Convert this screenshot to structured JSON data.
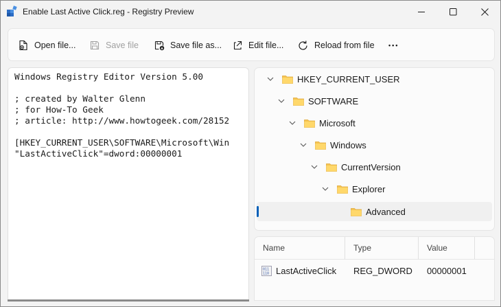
{
  "window": {
    "title": "Enable Last Active Click.reg - Registry Preview"
  },
  "toolbar": {
    "open_label": "Open file...",
    "save_label": "Save file",
    "saveas_label": "Save file as...",
    "edit_label": "Edit file...",
    "reload_label": "Reload from file",
    "more_label": "•••"
  },
  "editor": {
    "lines": [
      "Windows Registry Editor Version 5.00",
      "",
      "; created by Walter Glenn",
      "; for How-To Geek",
      "; article: http://www.howtogeek.com/28152",
      "",
      "[HKEY_CURRENT_USER\\SOFTWARE\\Microsoft\\Win",
      "\"LastActiveClick\"=dword:00000001"
    ]
  },
  "tree": {
    "nodes": [
      {
        "label": "HKEY_CURRENT_USER",
        "expanded": true
      },
      {
        "label": "SOFTWARE",
        "expanded": true
      },
      {
        "label": "Microsoft",
        "expanded": true
      },
      {
        "label": "Windows",
        "expanded": true
      },
      {
        "label": "CurrentVersion",
        "expanded": true
      },
      {
        "label": "Explorer",
        "expanded": true
      },
      {
        "label": "Advanced",
        "selected": true
      }
    ]
  },
  "values_table": {
    "headers": {
      "name": "Name",
      "type": "Type",
      "value": "Value"
    },
    "rows": [
      {
        "name": "LastActiveClick",
        "type": "REG_DWORD",
        "value": "00000001",
        "icon": "dword-value-icon"
      }
    ]
  },
  "colors": {
    "accent": "#005fb8",
    "folder": "#f5c451"
  }
}
